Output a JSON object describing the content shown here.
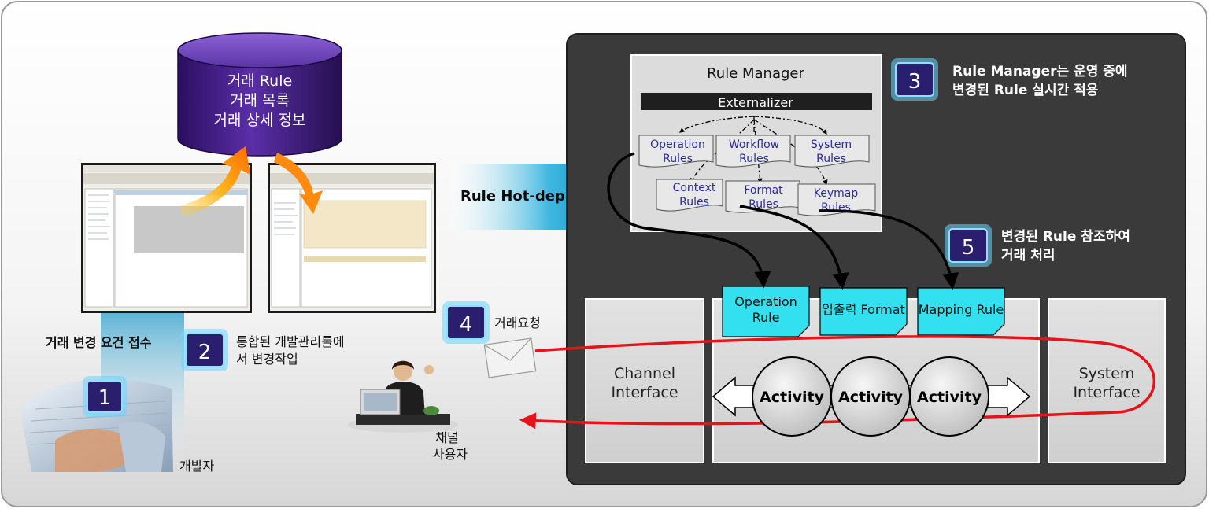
{
  "database": {
    "line1": "거래 Rule",
    "line2": "거래 목록",
    "line3": "거래 상세 정보"
  },
  "left": {
    "request_label": "거래 변경 요건 접수",
    "step1": "1",
    "step2": "2",
    "step2_text_line1": "통합된 개발관리툴에",
    "step2_text_line2": "서 변경작업",
    "developer_label": "개발자"
  },
  "hot_deploy_label": "Rule Hot-deploy",
  "step4": "4",
  "transaction_request_label": "거래요청",
  "channel_user_line1": "채널",
  "channel_user_line2": "사용자",
  "rule_manager": {
    "title": "Rule Manager",
    "externalizer": "Externalizer",
    "rules": [
      {
        "line1": "Operation",
        "line2": "Rules"
      },
      {
        "line1": "Workflow",
        "line2": "Rules"
      },
      {
        "line1": "System",
        "line2": "Rules"
      },
      {
        "line1": "Context",
        "line2": "Rules"
      },
      {
        "line1": "Format",
        "line2": "Rules"
      },
      {
        "line1": "Keymap",
        "line2": "Rules"
      }
    ]
  },
  "step3": "3",
  "step3_text_line1": "Rule Manager는 운영 중에",
  "step3_text_line2": "변경된 Rule 실시간 적용",
  "step5": "5",
  "step5_text_line1": "변경된 Rule 참조하여",
  "step5_text_line2": "거래 처리",
  "notes": [
    {
      "line1": "Operation",
      "line2": "Rule"
    },
    {
      "line1": "입출력 Format",
      "line2": ""
    },
    {
      "line1": "Mapping Rule",
      "line2": ""
    }
  ],
  "channel_interface": {
    "line1": "Channel",
    "line2": "Interface"
  },
  "system_interface": {
    "line1": "System",
    "line2": "Interface"
  },
  "activities": [
    "Activity",
    "Activity",
    "Activity"
  ],
  "colors": {
    "dark_panel": "#3a3a3a",
    "badge_fill": "#2a1e6e",
    "badge_glow": "#33c7ff",
    "note_fill": "#33e0f0",
    "red_loop": "#e8121b",
    "db_fill": "#3a1a78",
    "rule_text": "#2a2a9a"
  }
}
